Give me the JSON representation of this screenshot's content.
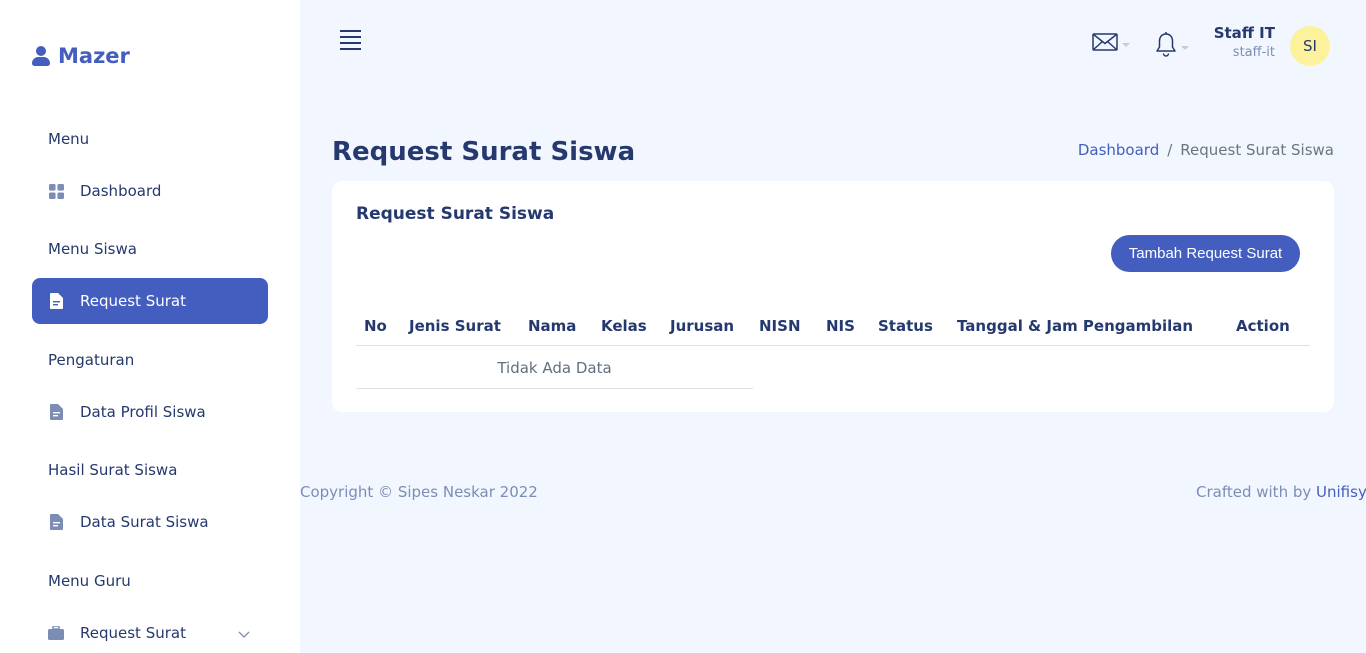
{
  "brand": {
    "name": "Mazer",
    "icon": "user-icon"
  },
  "sidebar": {
    "sections": [
      {
        "title": "Menu",
        "item": {
          "label": "Dashboard",
          "icon": "grid-icon"
        }
      },
      {
        "title": "Menu Siswa",
        "item": {
          "label": "Request Surat",
          "icon": "file-icon",
          "active": true
        }
      },
      {
        "title": "Pengaturan",
        "item": {
          "label": "Data Profil Siswa",
          "icon": "file-icon"
        }
      },
      {
        "title": "Hasil Surat Siswa",
        "item": {
          "label": "Data Surat Siswa",
          "icon": "file-icon"
        }
      },
      {
        "title": "Menu Guru",
        "item": {
          "label": "Request Surat",
          "icon": "briefcase-icon",
          "has_submenu": true
        }
      }
    ]
  },
  "header": {
    "icons": [
      "menu-icon",
      "envelope-icon",
      "bell-icon"
    ],
    "user": {
      "name": "Staff IT",
      "role": "staff-it",
      "initials": "SI"
    }
  },
  "page": {
    "title": "Request Surat Siswa",
    "breadcrumb": {
      "home": "Dashboard",
      "separator": "/",
      "current": "Request Surat Siswa"
    }
  },
  "card": {
    "title": "Request Surat Siswa",
    "add_button": "Tambah Request Surat",
    "columns": [
      "No",
      "Jenis Surat",
      "Nama",
      "Kelas",
      "Jurusan",
      "NISN",
      "NIS",
      "Status",
      "Tanggal & Jam Pengambilan",
      "Action"
    ],
    "empty_text": "Tidak Ada Data"
  },
  "footer": {
    "copyright": "Copyright © Sipes Neskar 2022",
    "crafted_prefix": "Crafted with by",
    "crafted_brand": "Unifisyt"
  },
  "colors": {
    "primary": "#435ebe",
    "background": "#f2f7ff",
    "text": "#25396f",
    "avatar": "#fdf29c"
  }
}
